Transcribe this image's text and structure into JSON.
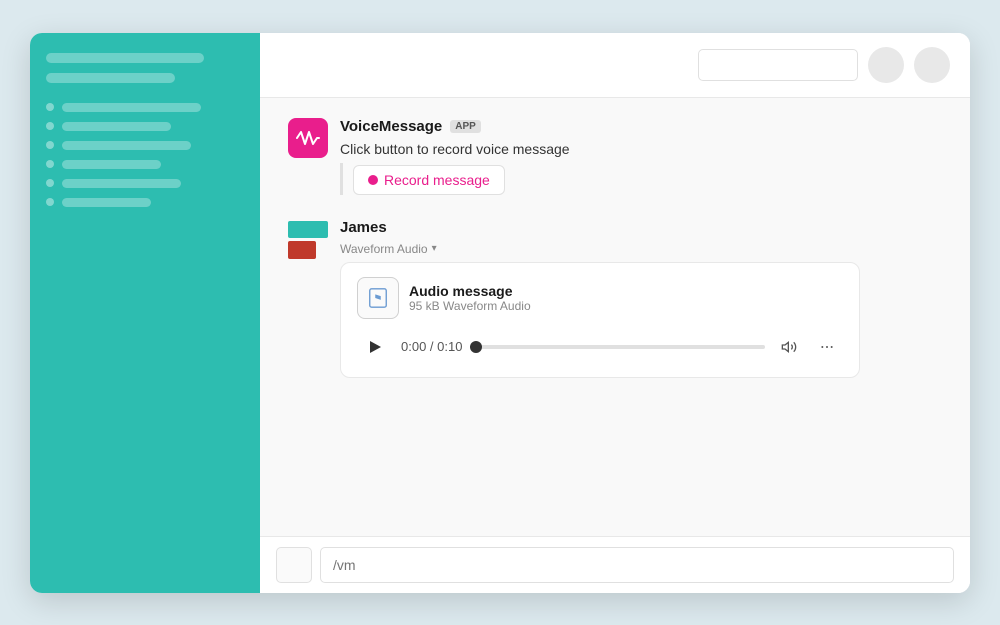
{
  "sidebar": {
    "bars": [
      {
        "width": "80%"
      },
      {
        "width": "65%"
      }
    ],
    "items": [
      {
        "dot": true,
        "bar_width": "70%"
      },
      {
        "dot": true,
        "bar_width": "55%"
      },
      {
        "dot": true,
        "bar_width": "65%"
      },
      {
        "dot": true,
        "bar_width": "50%"
      },
      {
        "dot": true,
        "bar_width": "60%"
      },
      {
        "dot": true,
        "bar_width": "45%"
      }
    ]
  },
  "topbar": {
    "search_placeholder": "",
    "btn1_label": "",
    "btn2_label": ""
  },
  "voicemessage": {
    "name": "VoiceMessage",
    "badge": "APP",
    "description": "Click button to record voice message",
    "record_button_label": "Record message"
  },
  "james": {
    "name": "James",
    "subtext": "Waveform Audio",
    "audio_card": {
      "file_name": "Audio message",
      "file_size": "95 kB Waveform Audio",
      "time_current": "0:00",
      "time_total": "0:10"
    }
  },
  "input": {
    "placeholder": "/vm"
  }
}
